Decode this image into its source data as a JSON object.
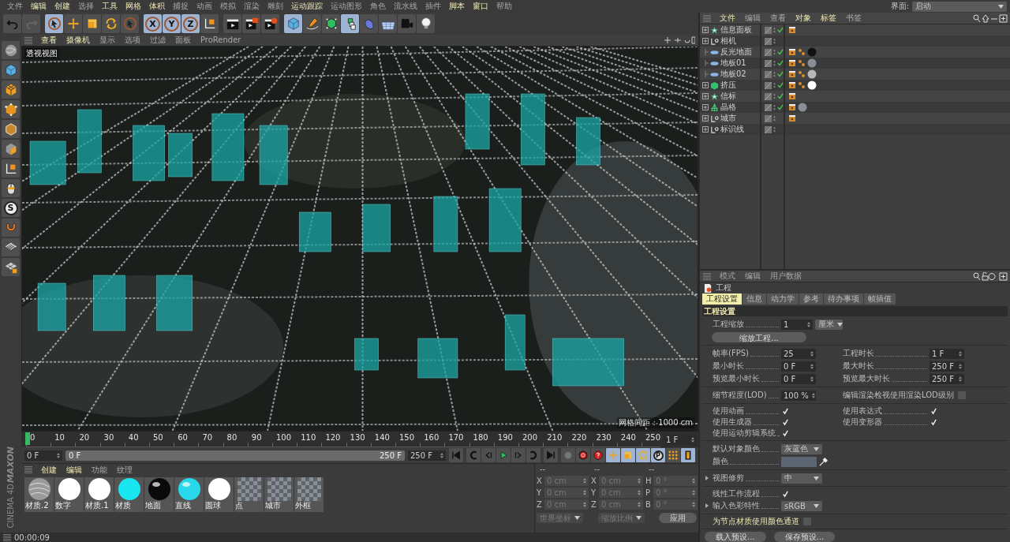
{
  "menu": [
    {
      "label": "文件",
      "bright": false
    },
    {
      "label": "编辑",
      "bright": true
    },
    {
      "label": "创建",
      "bright": true
    },
    {
      "label": "选择",
      "bright": false
    },
    {
      "label": "工具",
      "bright": true
    },
    {
      "label": "网格",
      "bright": true
    },
    {
      "label": "体积",
      "bright": true
    },
    {
      "label": "捕捉",
      "bright": false
    },
    {
      "label": "动画",
      "bright": false
    },
    {
      "label": "模拟",
      "bright": false
    },
    {
      "label": "渲染",
      "bright": false
    },
    {
      "label": "雕刻",
      "bright": false
    },
    {
      "label": "运动跟踪",
      "bright": true
    },
    {
      "label": "运动图形",
      "bright": false
    },
    {
      "label": "角色",
      "bright": false
    },
    {
      "label": "流水线",
      "bright": false
    },
    {
      "label": "插件",
      "bright": false
    },
    {
      "label": "脚本",
      "bright": true
    },
    {
      "label": "窗口",
      "bright": true
    },
    {
      "label": "帮助",
      "bright": false
    }
  ],
  "layout": {
    "label": "界面:",
    "value": "启动"
  },
  "toolbar": [
    [
      {
        "kind": "undo",
        "selected": false
      },
      {
        "kind": "redo",
        "selected": false
      }
    ],
    [
      {
        "kind": "cursor",
        "selected": true
      },
      {
        "kind": "move",
        "selected": false
      },
      {
        "kind": "scale",
        "selected": false
      },
      {
        "kind": "rotate",
        "selected": false
      },
      {
        "kind": "cursor",
        "selected": false
      }
    ],
    [
      {
        "kind": "axis",
        "label": "X",
        "selected": true
      },
      {
        "kind": "axis",
        "label": "Y",
        "selected": true
      },
      {
        "kind": "axis",
        "label": "Z",
        "selected": true
      },
      {
        "kind": "axes",
        "selected": false
      }
    ],
    [
      {
        "kind": "clapper",
        "selected": false
      },
      {
        "kind": "clapper-picture",
        "selected": false
      },
      {
        "kind": "clapper-gear",
        "selected": false
      }
    ],
    [
      {
        "kind": "cube",
        "selected": true
      },
      {
        "kind": "pen",
        "selected": false
      },
      {
        "kind": "subdivision",
        "selected": false
      },
      {
        "kind": "cloner",
        "selected": true
      },
      {
        "kind": "deformer",
        "selected": false
      },
      {
        "kind": "floor",
        "selected": false
      },
      {
        "kind": "camera",
        "selected": false
      },
      {
        "kind": "bulb",
        "selected": false
      }
    ]
  ],
  "sidebar": [
    {
      "kind": "sculpt"
    },
    {
      "kind": "cube"
    },
    {
      "kind": "checker"
    },
    {
      "kind": "points"
    },
    {
      "kind": "edges"
    },
    {
      "kind": "polygons"
    },
    {
      "kind": "axes"
    },
    {
      "kind": "mouse"
    },
    {
      "kind": "snap",
      "label": "S"
    },
    {
      "kind": "magnet"
    },
    {
      "kind": "grid"
    },
    {
      "kind": "grid-lock"
    }
  ],
  "logo": {
    "brand": "MAXON",
    "product": "CINEMA 4D"
  },
  "viewport": {
    "menu": [
      {
        "label": "查看",
        "bright": true
      },
      {
        "label": "摄像机",
        "bright": true
      },
      {
        "label": "显示",
        "bright": false
      },
      {
        "label": "选项",
        "bright": false
      },
      {
        "label": "过滤",
        "bright": false
      },
      {
        "label": "面板",
        "bright": false
      },
      {
        "label": "ProRender",
        "bright": false
      }
    ],
    "title": "透视视图",
    "grid_spacing": "网格间距 : 1000 cm"
  },
  "timeline": {
    "ticks": [
      "0",
      "10",
      "20",
      "30",
      "40",
      "50",
      "60",
      "70",
      "80",
      "90",
      "100",
      "110",
      "120",
      "130",
      "140",
      "150",
      "160",
      "170",
      "180",
      "190",
      "200",
      "210",
      "220",
      "230",
      "240",
      "250"
    ],
    "level": 0,
    "current": "1 F"
  },
  "playback": {
    "start": "0 F",
    "range": {
      "start": "0 F",
      "end": "250 F",
      "level": 1
    },
    "end": "250 F",
    "transport": [
      {
        "kind": "first"
      },
      {
        "kind": "prev-key"
      },
      {
        "kind": "prev-frame"
      },
      {
        "kind": "play"
      },
      {
        "kind": "next-frame"
      },
      {
        "kind": "next-key"
      },
      {
        "kind": "last"
      }
    ],
    "keys": [
      {
        "kind": "record-disabled",
        "selected": false
      },
      {
        "kind": "record",
        "selected": false
      },
      {
        "kind": "help-key",
        "selected": false
      },
      {
        "kind": "move",
        "selected": true
      },
      {
        "kind": "scale",
        "selected": true
      },
      {
        "kind": "rotate",
        "selected": true
      },
      {
        "kind": "param",
        "label": "P",
        "selected": true
      },
      {
        "kind": "dots",
        "selected": false
      },
      {
        "kind": "film",
        "selected": true
      }
    ]
  },
  "materials": {
    "menu": [
      {
        "label": "创建",
        "bright": true
      },
      {
        "label": "编辑",
        "bright": true
      },
      {
        "label": "功能",
        "bright": false
      },
      {
        "label": "纹理",
        "bright": false
      }
    ],
    "items": [
      {
        "name": "材质.2",
        "kind": "noise",
        "color": "#9a9a9a"
      },
      {
        "name": "数字",
        "kind": "sphere",
        "color": "#ffffff"
      },
      {
        "name": "材质.1",
        "kind": "sphere",
        "color": "#ffffff"
      },
      {
        "name": "材质",
        "kind": "sphere",
        "color": "#19e6f0"
      },
      {
        "name": "地面",
        "kind": "glossy",
        "color": "#0a0a0a"
      },
      {
        "name": "直线",
        "kind": "glossy",
        "color": "#2ad8ec"
      },
      {
        "name": "圆球",
        "kind": "sphere",
        "color": "#ffffff"
      },
      {
        "name": "点",
        "kind": "checker",
        "color": "#8a8f96"
      },
      {
        "name": "城市",
        "kind": "checker",
        "color": "#8a8f96"
      },
      {
        "name": "外框",
        "kind": "checker",
        "color": "#8a8f96"
      }
    ]
  },
  "coordinates": {
    "columns": [
      {
        "header": "--",
        "fields": [
          {
            "axis": "X",
            "value": "0 cm"
          },
          {
            "axis": "Y",
            "value": "0 cm"
          },
          {
            "axis": "Z",
            "value": "0 cm"
          }
        ]
      },
      {
        "header": "--",
        "fields": [
          {
            "axis": "X",
            "value": "0 cm"
          },
          {
            "axis": "Y",
            "value": "0 cm"
          },
          {
            "axis": "Z",
            "value": "0 cm"
          }
        ]
      },
      {
        "header": "--",
        "fields": [
          {
            "axis": "H",
            "value": "0 °"
          },
          {
            "axis": "P",
            "value": "0 °"
          },
          {
            "axis": "B",
            "value": "0 °"
          }
        ]
      }
    ],
    "mode": "世界坐标",
    "scale": "缩放比例",
    "apply": "应用"
  },
  "status": "00:00:09",
  "objects": {
    "menu": [
      {
        "label": "文件",
        "bright": true
      },
      {
        "label": "编辑",
        "bright": false
      },
      {
        "label": "查看",
        "bright": false
      },
      {
        "label": "对象",
        "bright": true
      },
      {
        "label": "标签",
        "bright": true
      },
      {
        "label": "书签",
        "bright": false
      }
    ],
    "rows": [
      {
        "name": "信息面板",
        "kind": "star",
        "expandable": true,
        "enabled": true,
        "tags": [
          {
            "kind": "compositing"
          }
        ]
      },
      {
        "name": "相机",
        "kind": "null",
        "expandable": true,
        "enabled": false,
        "tags": []
      },
      {
        "name": "反光地面",
        "kind": "floor",
        "expandable": false,
        "enabled": true,
        "tags": [
          {
            "kind": "compositing"
          },
          {
            "kind": "phong"
          },
          {
            "kind": "material",
            "color": "#111111"
          }
        ]
      },
      {
        "name": "地板01",
        "kind": "floor",
        "expandable": false,
        "enabled": true,
        "tags": [
          {
            "kind": "compositing"
          },
          {
            "kind": "phong"
          },
          {
            "kind": "material",
            "color": "#8a8f96"
          }
        ]
      },
      {
        "name": "地板02",
        "kind": "floor",
        "expandable": false,
        "enabled": true,
        "tags": [
          {
            "kind": "compositing"
          },
          {
            "kind": "phong"
          },
          {
            "kind": "material",
            "color": "#b8b8b8"
          }
        ]
      },
      {
        "name": "挤压",
        "kind": "extrude",
        "expandable": true,
        "enabled": true,
        "tags": [
          {
            "kind": "compositing"
          },
          {
            "kind": "phong"
          },
          {
            "kind": "material",
            "color": "#ffffff"
          }
        ]
      },
      {
        "name": "信标",
        "kind": "star",
        "expandable": true,
        "enabled": true,
        "tags": [
          {
            "kind": "compositing"
          }
        ]
      },
      {
        "name": "晶格",
        "kind": "lattice",
        "expandable": true,
        "enabled": true,
        "tags": [
          {
            "kind": "compositing"
          },
          {
            "kind": "material",
            "color": "#8a8f96"
          }
        ]
      },
      {
        "name": "城市",
        "kind": "null",
        "expandable": true,
        "enabled": false,
        "tags": [
          {
            "kind": "compositing"
          }
        ]
      },
      {
        "name": "标识线",
        "kind": "null",
        "expandable": true,
        "enabled": false,
        "tags": []
      }
    ]
  },
  "attributes": {
    "menu": [
      {
        "label": "模式"
      },
      {
        "label": "编辑"
      },
      {
        "label": "用户数据"
      }
    ],
    "title": "工程",
    "tabs": [
      {
        "label": "工程设置",
        "selected": true
      },
      {
        "label": "信息",
        "selected": false
      },
      {
        "label": "动力学",
        "selected": false
      },
      {
        "label": "参考",
        "selected": false
      },
      {
        "label": "待办事项",
        "selected": false
      },
      {
        "label": "帧插值",
        "selected": false
      }
    ],
    "section": "工程设置",
    "groups": [
      [
        [
          {
            "kind": "number",
            "label": "工程缩放",
            "value": "1",
            "unit": "厘米"
          }
        ],
        [
          {
            "kind": "button",
            "label": "缩放工程..."
          }
        ]
      ],
      [
        [
          {
            "kind": "number",
            "label": "帧率(FPS)",
            "value": "25"
          },
          {
            "kind": "number",
            "label": "工程时长",
            "value": "1 F"
          }
        ],
        [
          {
            "kind": "number",
            "label": "最小时长",
            "value": "0 F"
          },
          {
            "kind": "number",
            "label": "最大时长",
            "value": "250 F"
          }
        ],
        [
          {
            "kind": "number",
            "label": "预览最小时长",
            "value": "0 F"
          },
          {
            "kind": "number",
            "label": "预览最大时长",
            "value": "250 F"
          }
        ]
      ],
      [
        [
          {
            "kind": "number",
            "label": "细节程度(LOD)",
            "value": "100 %"
          },
          {
            "kind": "check",
            "label": "编辑渲染检视使用渲染LOD级别",
            "checked": false
          }
        ]
      ],
      [
        [
          {
            "kind": "check",
            "label": "使用动画",
            "checked": true
          },
          {
            "kind": "check",
            "label": "使用表达式",
            "checked": true
          }
        ],
        [
          {
            "kind": "check",
            "label": "使用生成器",
            "checked": true
          },
          {
            "kind": "check",
            "label": "使用变形器",
            "checked": true
          }
        ],
        [
          {
            "kind": "check",
            "label": "使用运动剪辑系统",
            "checked": true
          }
        ]
      ],
      [
        [
          {
            "kind": "select",
            "label": "默认对象颜色",
            "value": "灰蓝色"
          }
        ],
        [
          {
            "kind": "color",
            "label": "颜色"
          }
        ]
      ],
      [
        [
          {
            "kind": "select",
            "label": "视图修剪",
            "value": "中",
            "expandable": true
          }
        ]
      ],
      [
        [
          {
            "kind": "check",
            "label": "线性工作流程",
            "checked": true
          }
        ],
        [
          {
            "kind": "select",
            "label": "输入色彩特性",
            "value": "sRGB",
            "expandable": true
          }
        ]
      ],
      [
        [
          {
            "kind": "check",
            "label": "为节点材质使用颜色通道",
            "checked": false,
            "bright": true
          }
        ]
      ]
    ],
    "buttons": [
      "载入预设...",
      "保存预设..."
    ]
  }
}
